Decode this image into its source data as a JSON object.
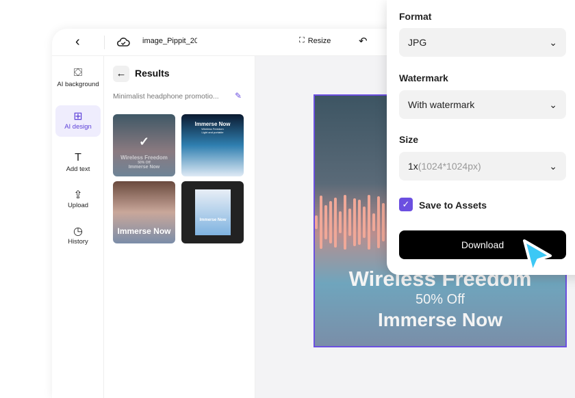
{
  "header": {
    "file_name": "image_Pippit_20",
    "resize_label": "Resize"
  },
  "sidebar": {
    "items": [
      {
        "label": "AI background"
      },
      {
        "label": "AI design"
      },
      {
        "label": "Add text"
      },
      {
        "label": "Upload"
      },
      {
        "label": "History"
      }
    ]
  },
  "panel": {
    "title": "Results",
    "prompt": "Minimalist headphone promotio...",
    "thumbs": [
      {
        "line1": "Wireless Freedom",
        "line2": "50% Off",
        "line3": "Immerse Now"
      },
      {
        "line1": "Immerse Now",
        "line2": "Wireless Freedom",
        "line3": "Light and portable"
      },
      {
        "line1": "Immerse Now"
      },
      {
        "line1": "Immerse Now"
      }
    ]
  },
  "poster": {
    "headline": "Wireless Freedom",
    "offer": "50% Off",
    "cta": "Immerse Now"
  },
  "export": {
    "format_label": "Format",
    "format_value": "JPG",
    "watermark_label": "Watermark",
    "watermark_value": "With watermark",
    "size_label": "Size",
    "size_value": "1x",
    "size_detail": "(1024*1024px)",
    "save_label": "Save to Assets",
    "save_checked": true,
    "download_label": "Download"
  },
  "colors": {
    "accent": "#6b4fe0",
    "cursor": "#3cc8f5"
  }
}
